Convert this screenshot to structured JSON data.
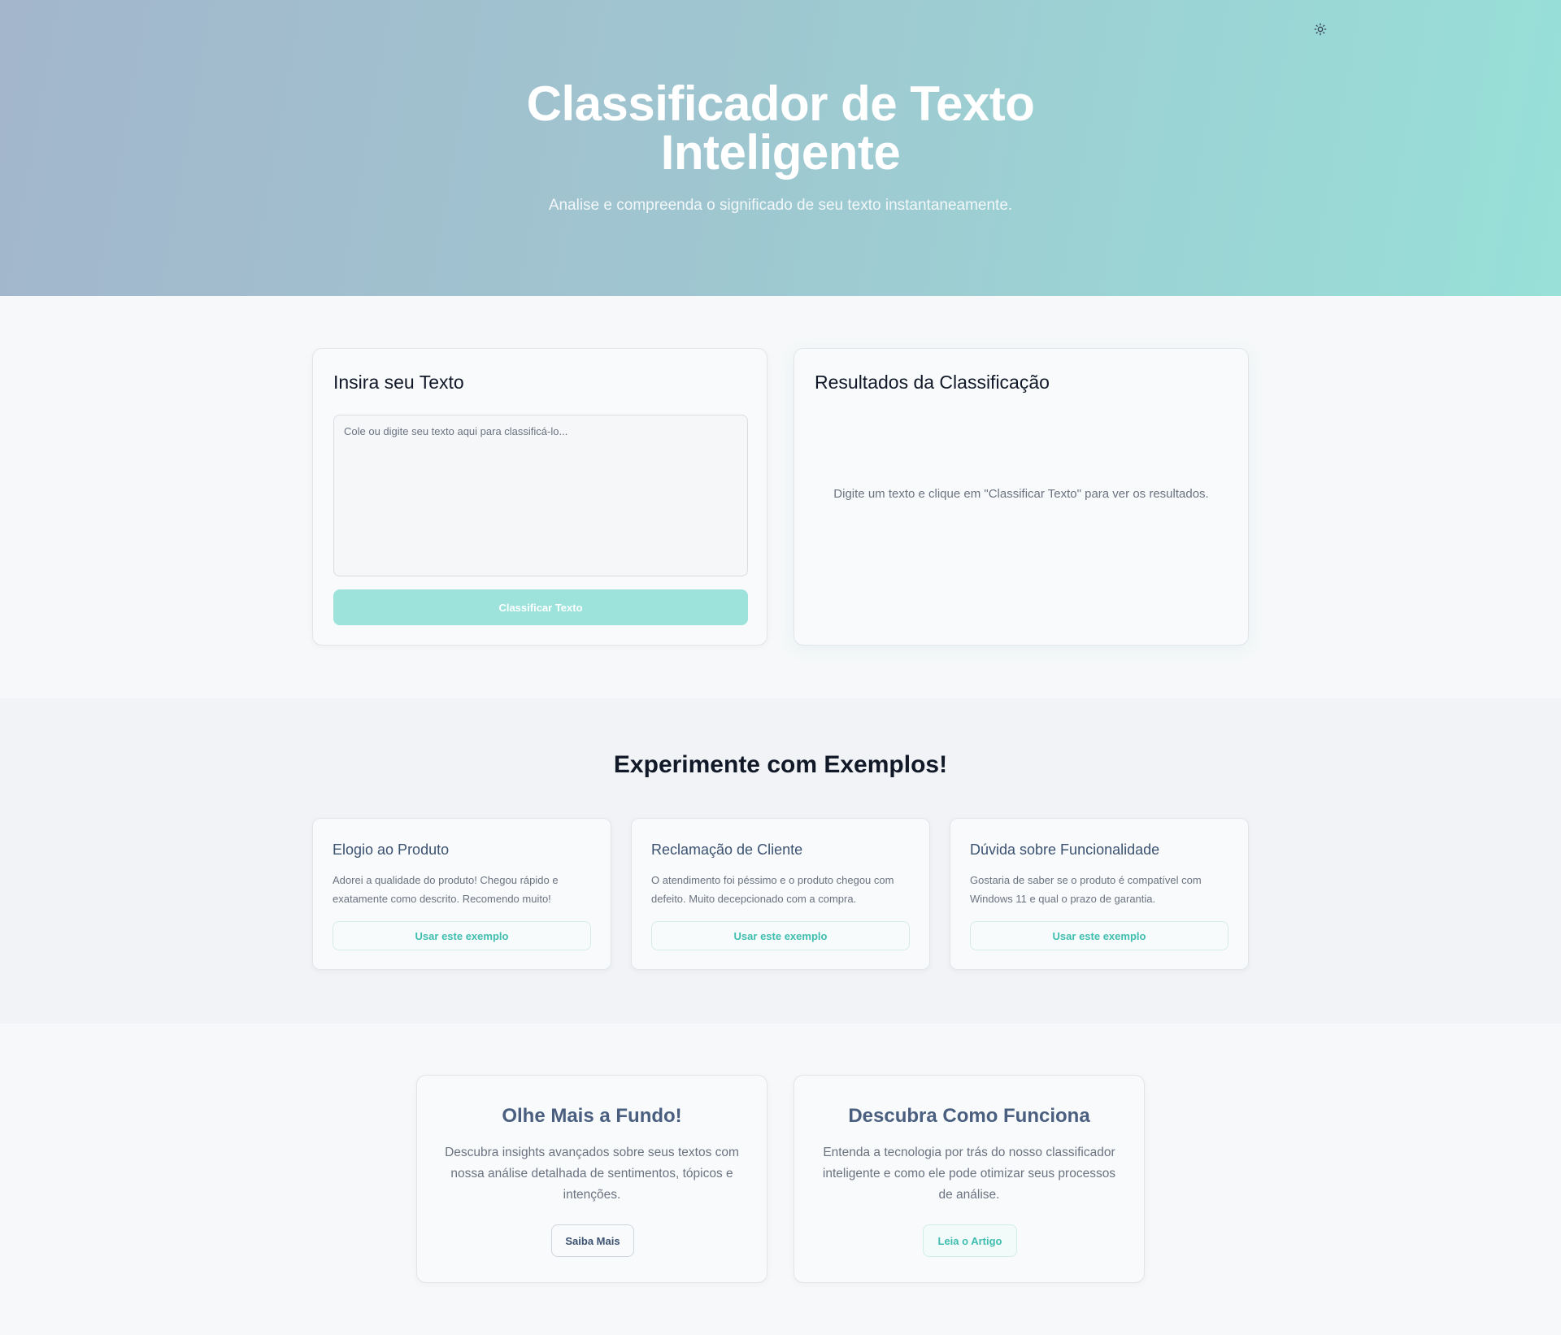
{
  "theme_toggle": {
    "icon": "sun-icon"
  },
  "hero": {
    "title": "Classificador de Texto Inteligente",
    "subtitle": "Analise e compreenda o significado de seu texto instantaneamente."
  },
  "input_panel": {
    "title": "Insira seu Texto",
    "textarea_placeholder": "Cole ou digite seu texto aqui para classificá-lo...",
    "textarea_value": "",
    "classify_label": "Classificar Texto"
  },
  "results_panel": {
    "title": "Resultados da Classificação",
    "empty_message": "Digite um texto e clique em \"Classificar Texto\" para ver os resultados."
  },
  "examples": {
    "title": "Experimente com Exemplos!",
    "items": [
      {
        "title": "Elogio ao Produto",
        "text": "Adorei a qualidade do produto! Chegou rápido e exatamente como descrito. Recomendo muito!",
        "button": "Usar este exemplo"
      },
      {
        "title": "Reclamação de Cliente",
        "text": "O atendimento foi péssimo e o produto chegou com defeito. Muito decepcionado com a compra.",
        "button": "Usar este exemplo"
      },
      {
        "title": "Dúvida sobre Funcionalidade",
        "text": "Gostaria de saber se o produto é compatível com Windows 11 e qual o prazo de garantia.",
        "button": "Usar este exemplo"
      }
    ]
  },
  "info_cards": [
    {
      "title": "Olhe Mais a Fundo!",
      "text": "Descubra insights avançados sobre seus textos com nossa análise detalhada de sentimentos, tópicos e intenções.",
      "button": "Saiba Mais"
    },
    {
      "title": "Descubra Como Funciona",
      "text": "Entenda a tecnologia por trás do nosso classificador inteligente e como ele pode otimizar seus processos de análise.",
      "button": "Leia o Artigo"
    }
  ],
  "colors": {
    "accent": "#3fbdb0",
    "accent_light": "#9de3dc",
    "hero_gradient_start": "#a3b6cc",
    "hero_gradient_end": "#98e0d8"
  }
}
